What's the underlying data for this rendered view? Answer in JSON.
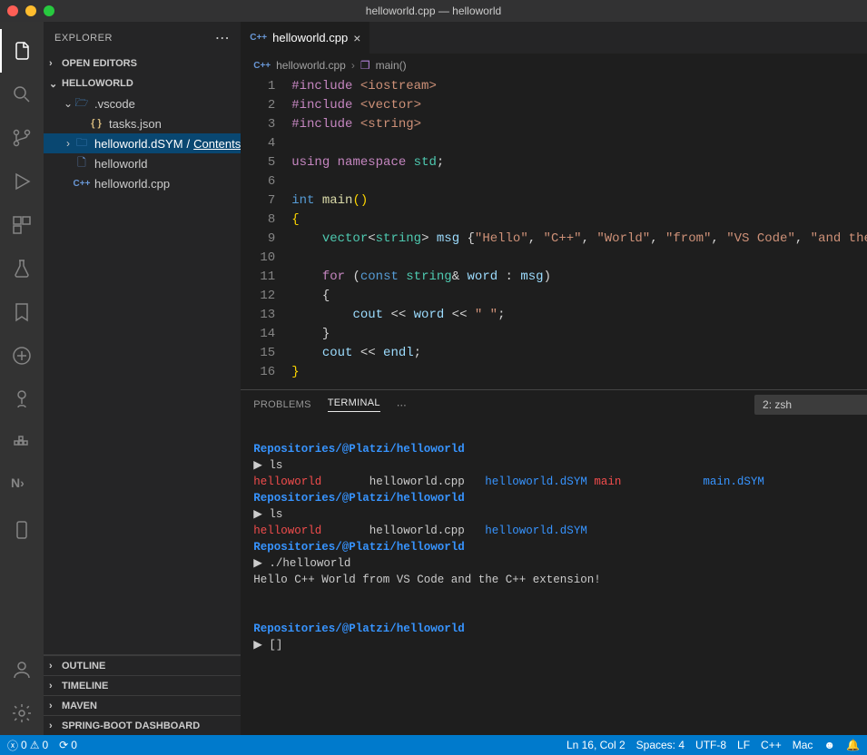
{
  "window_title": "helloworld.cpp — helloworld",
  "explorer": {
    "title": "EXPLORER",
    "sections": {
      "open_editors": "OPEN EDITORS",
      "workspace": "HELLOWORLD",
      "outline": "OUTLINE",
      "timeline": "TIMELINE",
      "maven": "MAVEN",
      "springboot": "SPRING-BOOT DASHBOARD"
    },
    "tree": {
      "vscode_folder": ".vscode",
      "tasks_json": "tasks.json",
      "dsym_folder": "helloworld.dSYM",
      "dsym_contents": "Contents",
      "helloworld_bin": "helloworld",
      "helloworld_cpp": "helloworld.cpp"
    }
  },
  "tab": {
    "name": "helloworld.cpp",
    "lang_badge": "C++"
  },
  "breadcrumb": {
    "file": "helloworld.cpp",
    "symbol": "main()"
  },
  "code": {
    "lines": [
      "#include <iostream>",
      "#include <vector>",
      "#include <string>",
      "",
      "using namespace std;",
      "",
      "int main()",
      "{",
      "    vector<string> msg {\"Hello\", \"C++\", \"World\", \"from\", \"VS Code\", \"and the C++ extension!\"};",
      "",
      "    for (const string& word : msg)",
      "    {",
      "        cout << word << \" \";",
      "    }",
      "    cout << endl;",
      "}"
    ]
  },
  "panel": {
    "problems": "PROBLEMS",
    "terminal": "TERMINAL",
    "term_select": "2: zsh"
  },
  "terminal": {
    "dir": "Repositories/@Platzi/helloworld",
    "prompt": "▶",
    "cmd_ls": "ls",
    "ls1_items": [
      "helloworld",
      "helloworld.cpp",
      "helloworld.dSYM",
      "main",
      "main.dSYM"
    ],
    "ls2_items": [
      "helloworld",
      "helloworld.cpp",
      "helloworld.dSYM"
    ],
    "cmd_run": "./helloworld",
    "output": "Hello C++ World from VS Code and the C++ extension!",
    "cursor": "[]"
  },
  "status": {
    "errors": "0",
    "warnings": "0",
    "sync": "0",
    "line_col": "Ln 16, Col 2",
    "spaces": "Spaces: 4",
    "encoding": "UTF-8",
    "eol": "LF",
    "lang": "C++",
    "os": "Mac"
  }
}
